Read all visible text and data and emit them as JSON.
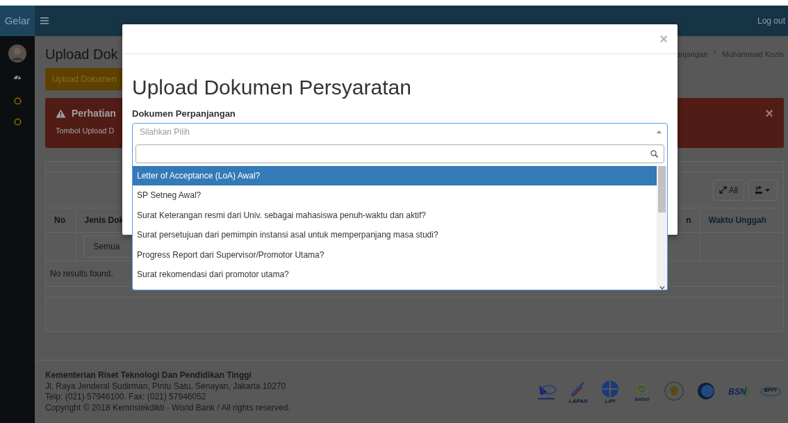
{
  "navbar": {
    "brand": "Gelar",
    "logout": "Log out"
  },
  "sidebar": {
    "items": [
      {
        "kind": "avatar"
      },
      {
        "kind": "dashboard"
      },
      {
        "kind": "circle"
      },
      {
        "kind": "circle"
      }
    ]
  },
  "page": {
    "title": "Upload Dok",
    "breadcrumb": [
      "anjangan",
      "Muhammad Kozin"
    ],
    "upload_button": "Upload Dokumen",
    "alert": {
      "title": "Perhatian",
      "text": "Tombol Upload D",
      "close": "×"
    },
    "toolbar": {
      "toggle_all": "All"
    },
    "table": {
      "columns": [
        "No",
        "Jenis Dok",
        "n",
        "Waktu Unggah"
      ],
      "filter": "Semua",
      "empty": "No results found."
    }
  },
  "footer": {
    "org": "Kementerian Riset Teknologi Dan Pendidikan Tinggi",
    "lines": [
      "Jl. Raya Jenderal Sudirman, Pintu Satu, Senayan, Jakarta 10270",
      "Telp: (021) 57946100. Fax: (021) 57946052",
      "Copyright © 2018 Kemristekdikti - World Bank / All rights reserved."
    ],
    "logos": [
      {
        "kind": "satellite"
      },
      {
        "kind": "rocket",
        "label": "LAPAN"
      },
      {
        "kind": "emblem",
        "label": "LIPI"
      },
      {
        "kind": "atom",
        "label": "batan"
      },
      {
        "kind": "seal"
      },
      {
        "kind": "globe"
      },
      {
        "kind": "wordmark",
        "label": "BSN"
      },
      {
        "kind": "ellipse",
        "label": "BPPT"
      }
    ]
  },
  "modal": {
    "close": "×",
    "title": "Upload Dokumen Persyaratan",
    "label": "Dokumen Perpanjangan",
    "select": {
      "placeholder": "Silahkan Pilih",
      "expanded": true
    },
    "options": [
      {
        "label": "Letter of Acceptance (LoA) Awal?",
        "selected": true
      },
      {
        "label": "SP Setneg Awal?",
        "selected": false
      },
      {
        "label": "Surat Keterangan resmi dari Univ. sebagai mahasiswa penuh-waktu dan aktif?",
        "selected": false
      },
      {
        "label": "Surat persetujuan dari pemimpin instansi asal untuk memperpanjang masa studi?",
        "selected": false
      },
      {
        "label": "Progress Report dari Supervisor/Promotor Utama?",
        "selected": false
      },
      {
        "label": "Surat rekomendasi dari promotor utama?",
        "selected": false
      }
    ]
  }
}
